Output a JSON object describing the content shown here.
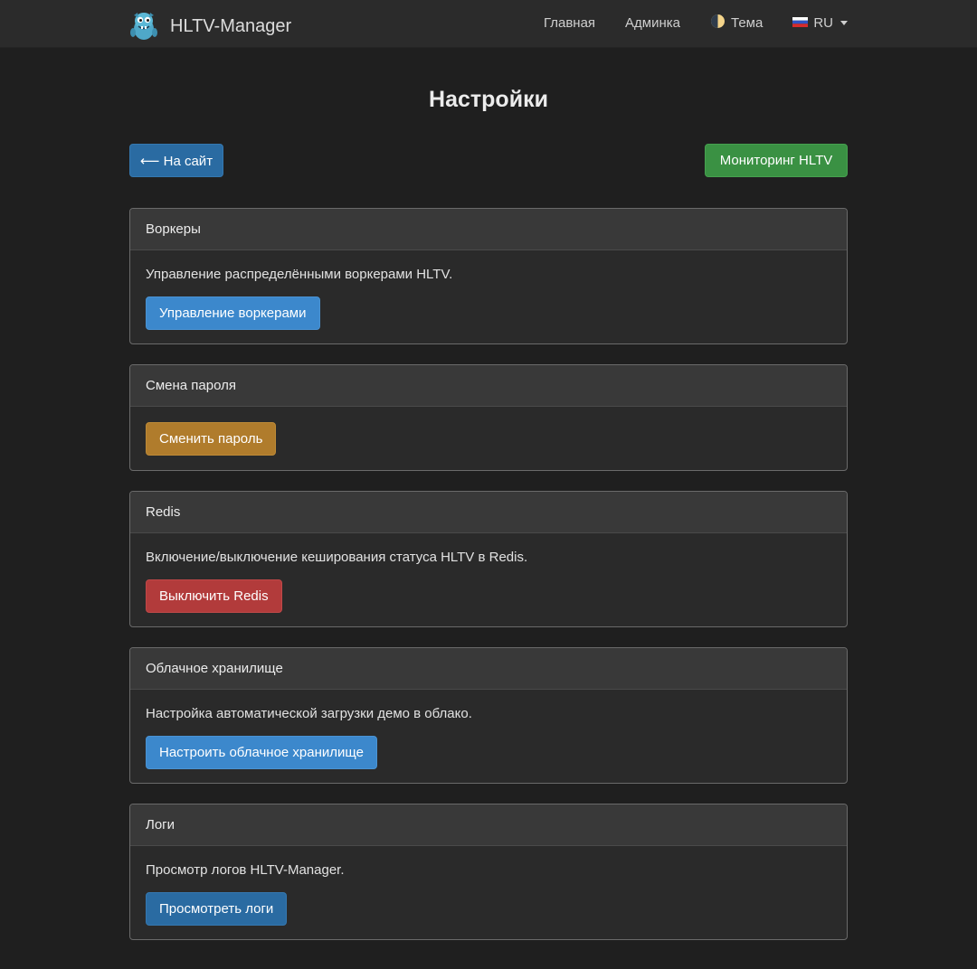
{
  "header": {
    "brand": "HLTV-Manager",
    "nav": {
      "home": "Главная",
      "admin": "Админка",
      "theme": "Тема",
      "lang": "RU"
    }
  },
  "page": {
    "title": "Настройки",
    "back_button": "⟵ На сайт",
    "monitor_button": "Мониторинг HLTV"
  },
  "cards": {
    "workers": {
      "title": "Воркеры",
      "text": "Управление распределёнными воркерами HLTV.",
      "button": "Управление воркерами"
    },
    "password": {
      "title": "Смена пароля",
      "button": "Сменить пароль"
    },
    "redis": {
      "title": "Redis",
      "text": "Включение/выключение кеширования статуса HLTV в Redis.",
      "button": "Выключить Redis"
    },
    "cloud": {
      "title": "Облачное хранилище",
      "text": "Настройка автоматической загрузки демо в облако.",
      "button": "Настроить облачное хранилище"
    },
    "logs": {
      "title": "Логи",
      "text": "Просмотр логов HLTV-Manager.",
      "button": "Просмотреть логи"
    }
  },
  "colors": {
    "background": "#1f1f1f",
    "navbar": "#2b2b2b",
    "primary": "#3c88cc",
    "primary_dark": "#2a6ba2",
    "success": "#3a9143",
    "warning": "#b07c2c",
    "danger": "#b23b3b"
  },
  "icons": {
    "brand": "mascot-logo-icon",
    "theme": "half-moon-icon",
    "lang": "russian-flag-icon",
    "lang_menu": "caret-down-icon"
  }
}
